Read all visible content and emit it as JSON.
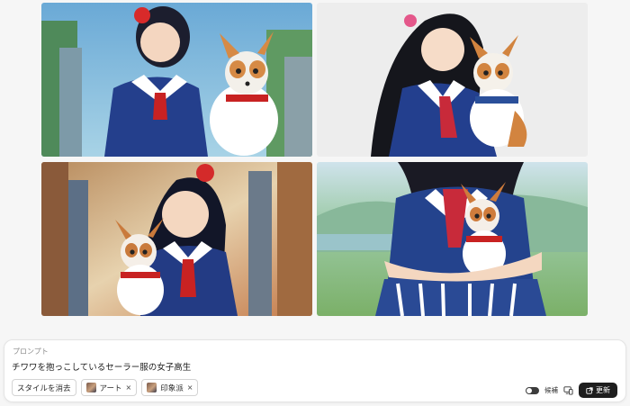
{
  "images": [
    {
      "alt": "",
      "colors": {
        "bg": "#7fb6d8",
        "accent": "#2f4f8f"
      }
    },
    {
      "alt": "",
      "colors": {
        "bg": "#ececec",
        "accent": "#2a4f9a"
      }
    },
    {
      "alt": "",
      "colors": {
        "bg": "#c9a57a",
        "accent": "#253c82"
      }
    },
    {
      "alt": "",
      "colors": {
        "bg": "#9cc7a8",
        "accent": "#26468f"
      }
    }
  ],
  "prompt": {
    "label": "プロンプト",
    "text": "チワワを抱っこしているセーラー服の女子高生"
  },
  "chips": {
    "clear_style": "スタイルを消去",
    "styles": [
      {
        "label": "アート",
        "remove": "×"
      },
      {
        "label": "印象派",
        "remove": "×"
      }
    ]
  },
  "controls": {
    "toggle_label": "候補",
    "update_label": "更新",
    "toggle_on": true
  }
}
